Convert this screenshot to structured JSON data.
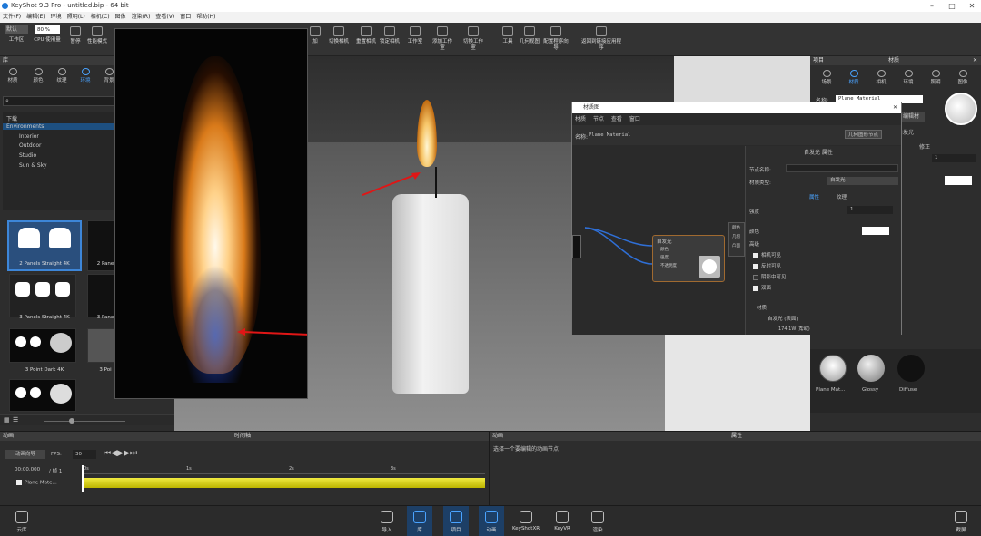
{
  "titlebar": {
    "title": "KeyShot 9.3 Pro - untitled.bip - 64 bit"
  },
  "menu": [
    "文件(F)",
    "编辑(E)",
    "环境",
    "照明(L)",
    "相机(C)",
    "图像",
    "渲染(R)",
    "查看(V)",
    "窗口",
    "帮助(H)"
  ],
  "toolbar": {
    "workspace": "默认",
    "cpu_value": "80 %",
    "items": [
      "工作区",
      "CPU 使用量",
      "暂停",
      "性能模式",
      "",
      "",
      "",
      "",
      "",
      "",
      "加",
      "切换相机",
      "重置相机",
      "锁定相机",
      "工作室",
      "添加工作室",
      "切换工作室",
      "工具",
      "几何视图",
      "配置程序向导",
      "",
      "返回到链接应用程序"
    ]
  },
  "library": {
    "title": "库",
    "tabs": [
      "材质",
      "颜色",
      "纹理",
      "环境",
      "背景"
    ],
    "active_tab": "环境",
    "tree": [
      {
        "label": "下载",
        "indent": 0
      },
      {
        "label": "Environments",
        "indent": 0,
        "selected": true
      },
      {
        "label": "Interior",
        "indent": 2
      },
      {
        "label": "Outdoor",
        "indent": 2
      },
      {
        "label": "Studio",
        "indent": 2
      },
      {
        "label": "Sun & Sky",
        "indent": 2
      }
    ],
    "thumbs": [
      "2 Panels Straight 4K",
      "2 Pane",
      "3 Panels Straight 4K",
      "3 Pane",
      "3 Point Dark 4K",
      "3 Poi",
      "",
      ""
    ]
  },
  "project": {
    "title": "项目",
    "subtitle": "材质",
    "tabs": [
      "场景",
      "材质",
      "相机",
      "环境",
      "照明",
      "图像"
    ],
    "active_tab": "材质",
    "name_label": "名称:",
    "name_value": "Plane Material",
    "edit_button": "编辑材",
    "self_light": "自发光",
    "mod_label": "修正",
    "val1": "1",
    "materials": [
      "Plane Mat...",
      "Glossy",
      "Diffuse"
    ]
  },
  "node_editor": {
    "title": "材质图",
    "menu": [
      "材质",
      "节点",
      "查看",
      "窗口"
    ],
    "name_label": "名称:",
    "name_value": "Plane Material",
    "geom_button": "几何图形节点",
    "node_title": "自发光",
    "node_ports": [
      "颜色",
      "强度",
      "不透明度"
    ],
    "side_ports": [
      "颜色",
      "几何",
      "凸面"
    ],
    "props_title": "自发光 属性",
    "node_name_label": "节点名称:",
    "mat_type_label": "材质类型:",
    "mat_type_value": "自发光",
    "subtabs": [
      "属性",
      "纹理"
    ],
    "intensity_label": "强度",
    "intensity_value": "1",
    "color_label": "颜色",
    "advanced": "高级",
    "checks": [
      "相机可见",
      "反射可见",
      "阴影中可见",
      "双面"
    ],
    "tree": [
      "材质",
      "自发光 (表面)",
      "174.1W (帮助)"
    ]
  },
  "animation": {
    "title": "动画",
    "timeline": "时间轴",
    "wizard": "动画向导",
    "fps_label": "FPS:",
    "fps_value": "30",
    "time": "00:00.000",
    "frame": "/ 帧 1",
    "ticks": [
      "0s",
      "1s",
      "2s",
      "3s"
    ],
    "track": "Plane Mate..."
  },
  "right_bottom": {
    "title": "动画",
    "props": "属性",
    "hint": "选择一个要编辑的动画节点"
  },
  "bottom_bar": {
    "cloud": "云库",
    "items": [
      "导入",
      "库",
      "项目",
      "动画",
      "KeyShotXR",
      "KeyVR",
      "渲染"
    ],
    "active": [
      "库",
      "项目",
      "动画"
    ],
    "right": "截屏"
  },
  "colors": {
    "accent": "#4aa3ff",
    "track": "#d7d000"
  }
}
